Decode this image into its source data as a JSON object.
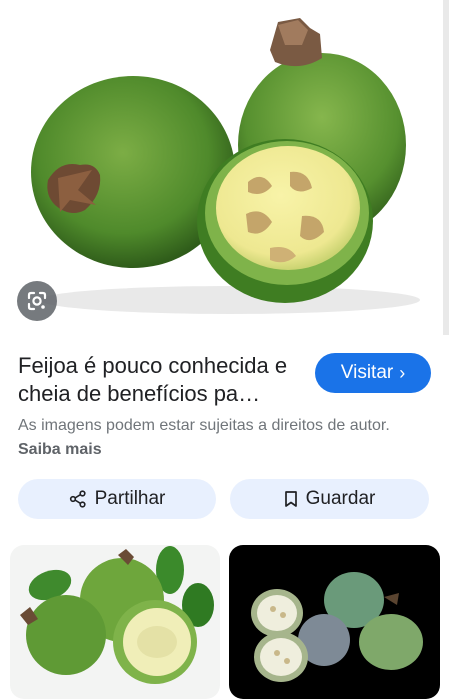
{
  "result": {
    "title": "Feijoa é pouco conhecida e cheia de benefícios pa…",
    "visit_label": "Visitar",
    "copyright_text": "As imagens podem estar sujeitas a direitos de autor.",
    "learn_more": "Saiba mais"
  },
  "actions": {
    "share_label": "Partilhar",
    "save_label": "Guardar"
  },
  "icons": {
    "lens": "google-lens-icon",
    "share": "share-icon",
    "save": "bookmark-icon",
    "visit": "chevron-right-icon"
  },
  "colors": {
    "accent": "#1a73e8",
    "action_bg": "#e8f0fe",
    "fruit_green": "#4f8a2b",
    "flesh": "#f3f0a0"
  }
}
